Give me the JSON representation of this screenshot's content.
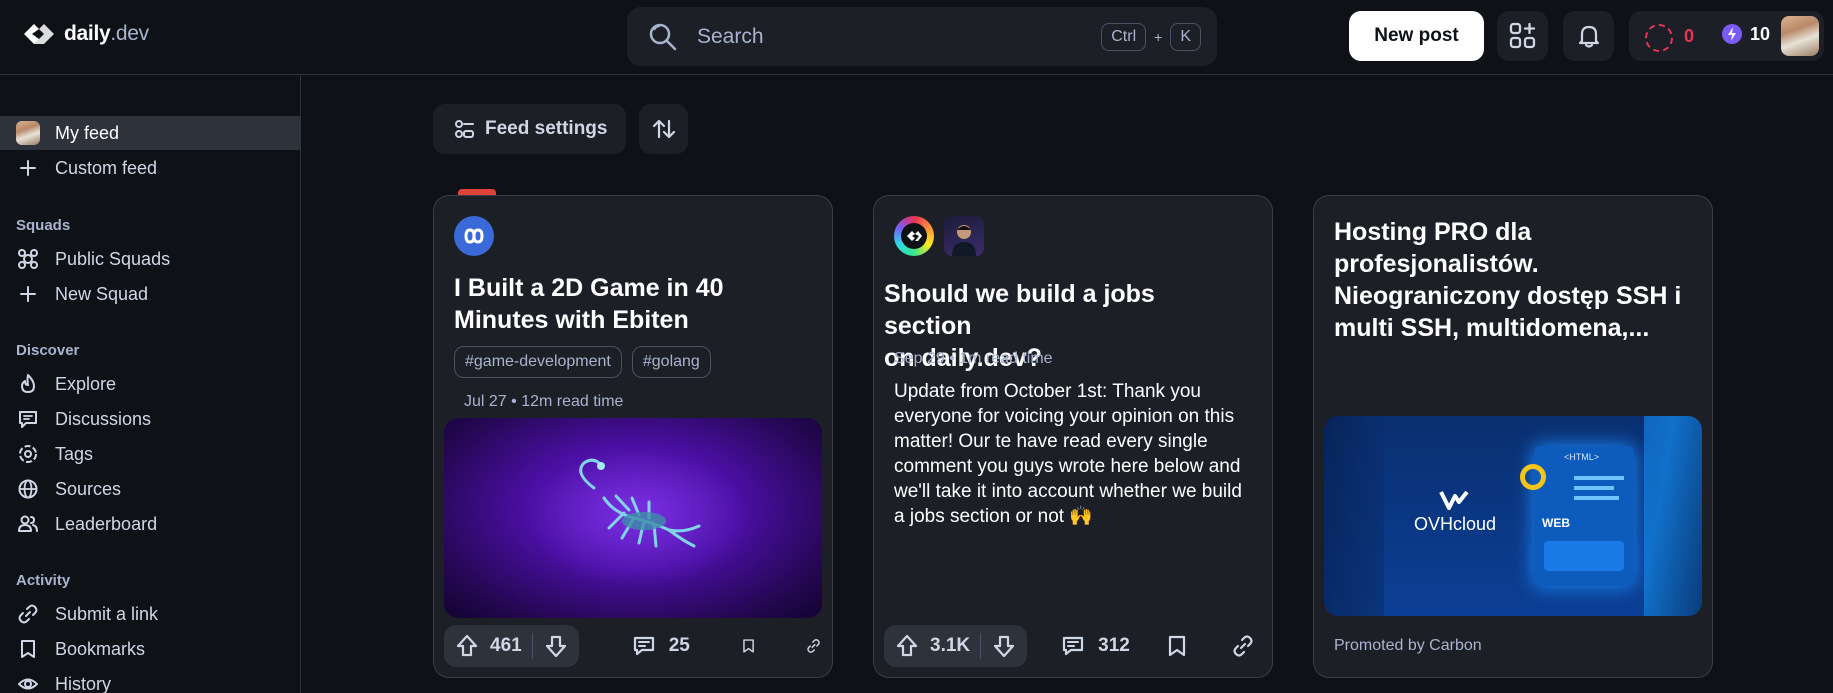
{
  "header": {
    "logo_main": "daily",
    "logo_suffix": ".dev",
    "search_placeholder": "Search",
    "shortcut_key1": "Ctrl",
    "shortcut_plus": "+",
    "shortcut_key2": "K",
    "new_post_label": "New post",
    "reputation": "0",
    "streak": "10",
    "colors": {
      "reputation": "#e63456",
      "streak": "#7a5af8"
    }
  },
  "sidebar": {
    "primary": [
      {
        "label": "My feed",
        "icon": "avatar",
        "active": true
      },
      {
        "label": "Custom feed",
        "icon": "plus-icon"
      }
    ],
    "squads_heading": "Squads",
    "squads": [
      {
        "label": "Public Squads",
        "icon": "squads-icon"
      },
      {
        "label": "New Squad",
        "icon": "plus-icon"
      }
    ],
    "discover_heading": "Discover",
    "discover": [
      {
        "label": "Explore",
        "icon": "flame-icon"
      },
      {
        "label": "Discussions",
        "icon": "chat-icon"
      },
      {
        "label": "Tags",
        "icon": "hashtag-icon"
      },
      {
        "label": "Sources",
        "icon": "globe-icon"
      },
      {
        "label": "Leaderboard",
        "icon": "users-icon"
      }
    ],
    "activity_heading": "Activity",
    "activity": [
      {
        "label": "Submit a link",
        "icon": "link-icon"
      },
      {
        "label": "Bookmarks",
        "icon": "bookmark-icon"
      },
      {
        "label": "History",
        "icon": "eye-icon"
      }
    ]
  },
  "toolbar": {
    "feed_settings_label": "Feed settings"
  },
  "cards": [
    {
      "title_line1": "I Built a 2D Game in 40",
      "title_line2": "Minutes with Ebiten",
      "tags": [
        "#game-development",
        "#golang"
      ],
      "meta": "Jul 27 • 12m read time",
      "upvotes": "461",
      "comments": "25"
    },
    {
      "title_line1": "Should we build a jobs section",
      "title_line2": "on daily.dev?",
      "meta": "Sep 29 • 1m read time",
      "body_lines": [
        "Update from October 1st: Thank you",
        "everyone for voicing your opinion on this",
        "matter! Our te have read every single",
        "comment you guys wrote here below and",
        "we'll take it into account whether we build",
        "a jobs section or not 🙌"
      ],
      "upvotes": "3.1K",
      "comments": "312"
    },
    {
      "title_lines": [
        "Hosting PRO dla",
        "profesjonalistów.",
        "Nieograniczony dostęp SSH i",
        "multi SSH, multidomena,..."
      ],
      "ad_brand": "OVHcloud",
      "ad_badge": "<HTML>",
      "ad_web": "WEB",
      "promoted": "Promoted by Carbon"
    }
  ]
}
